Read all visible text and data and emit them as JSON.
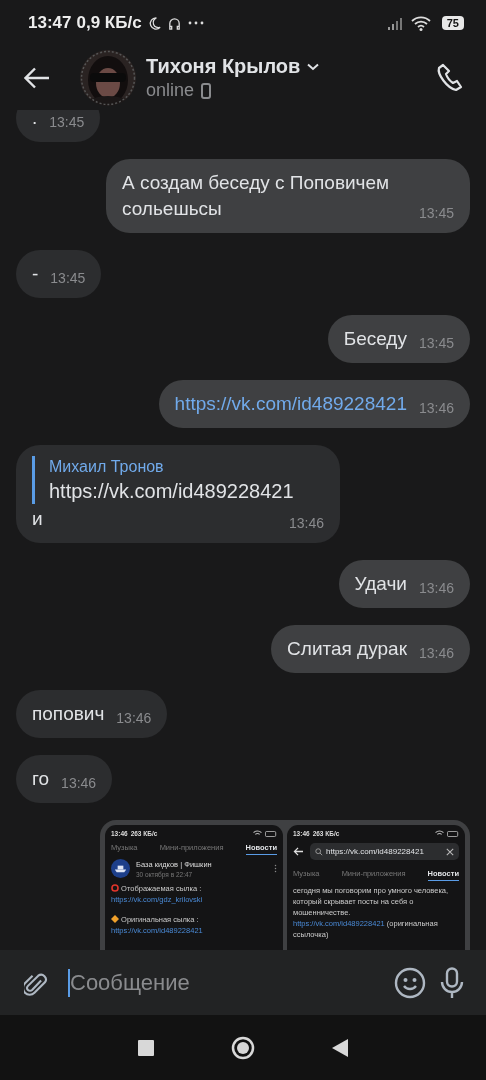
{
  "status_bar": {
    "time": "13:47",
    "speed": "0,9 КБ/с",
    "battery": "75"
  },
  "header": {
    "name": "Тихоня Крылов",
    "status": "online"
  },
  "messages": [
    {
      "kind": "text",
      "outgoing": false,
      "text": ".",
      "time": "13:45"
    },
    {
      "kind": "text",
      "outgoing": true,
      "text": "А создам беседу с Поповичем сольешьсы",
      "time": "13:45"
    },
    {
      "kind": "text",
      "outgoing": false,
      "text": "-",
      "time": "13:45"
    },
    {
      "kind": "text",
      "outgoing": true,
      "text": "Беседу",
      "time": "13:45"
    },
    {
      "kind": "link",
      "outgoing": true,
      "text": "https://vk.com/id489228421",
      "time": "13:46"
    },
    {
      "kind": "reply",
      "outgoing": false,
      "author": "Михаил Тронов",
      "quote": "https://vk.com/id489228421",
      "text": "и",
      "time": "13:46"
    },
    {
      "kind": "text",
      "outgoing": true,
      "text": "Удачи",
      "time": "13:46"
    },
    {
      "kind": "text",
      "outgoing": true,
      "text": "Слитая дурак",
      "time": "13:46"
    },
    {
      "kind": "text",
      "outgoing": false,
      "text": "попович",
      "time": "13:46"
    },
    {
      "kind": "text",
      "outgoing": false,
      "text": "го",
      "time": "13:46"
    },
    {
      "kind": "screenshot",
      "outgoing": true,
      "panels": [
        {
          "kind": "feed",
          "time": "13:46",
          "speed": "263 КБ/с",
          "tabs": [
            {
              "label": "Музыка",
              "selected": false
            },
            {
              "label": "Мини-приложения",
              "selected": false
            },
            {
              "label": "Новости",
              "selected": true
            }
          ],
          "author": "База кидков | Фишкин",
          "date": "30 октября в 22:47",
          "lines": [
            {
              "label": "Отображаемая сылка : ",
              "link": "https://vk.com/gdz_krilovski"
            },
            {
              "label": "Оригинальная сылка : ",
              "link": "https://vk.com/id489228421"
            }
          ]
        },
        {
          "kind": "search",
          "time": "13:46",
          "speed": "263 КБ/с",
          "query": "https://vk.com/id489228421",
          "tabs": [
            {
              "label": "Музыка",
              "selected": false
            },
            {
              "label": "Мини-приложения",
              "selected": false
            },
            {
              "label": "Новости",
              "selected": true
            }
          ],
          "text": "сегодня мы поговорим про умного человека, который скрывает посты на себя о мошенничестве.",
          "link": "https://vk.com/id489228421",
          "after": "(оригинальная ссылочка)"
        }
      ]
    }
  ],
  "composer": {
    "placeholder": "Сообщение"
  }
}
